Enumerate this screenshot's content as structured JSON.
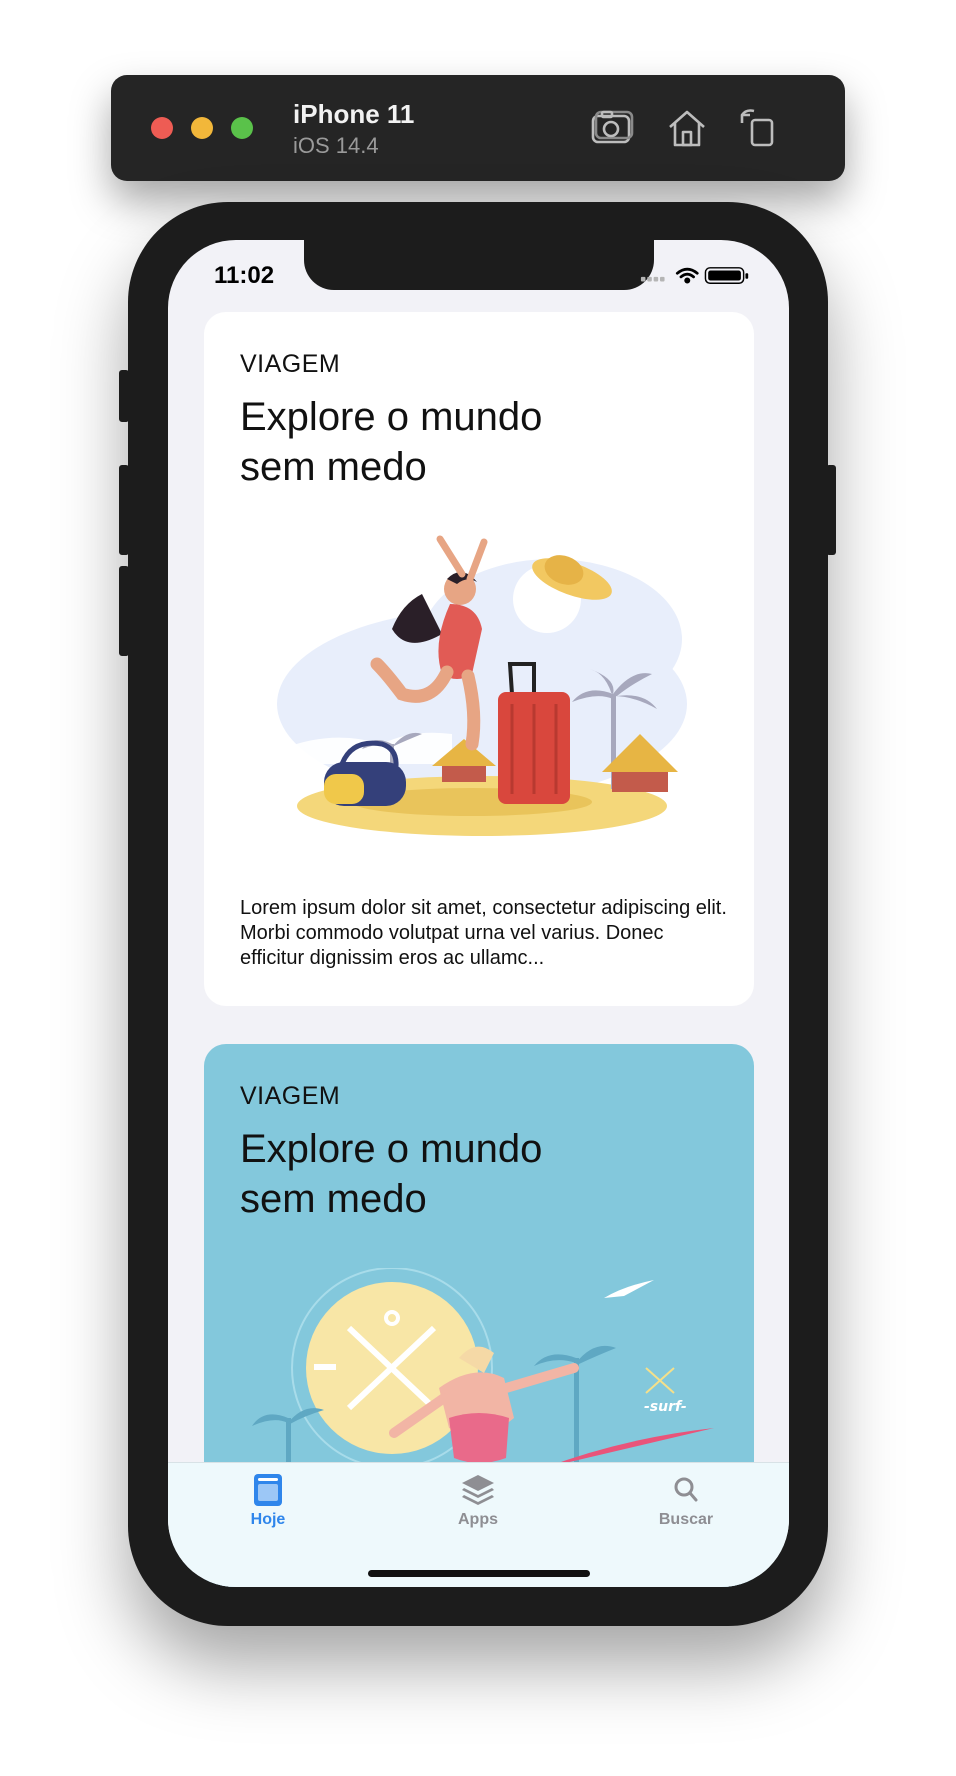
{
  "simulator": {
    "device": "iPhone 11",
    "os": "iOS 14.4",
    "icons": [
      "screenshot-icon",
      "home-icon",
      "rotate-icon"
    ]
  },
  "status_bar": {
    "time": "11:02"
  },
  "cards": [
    {
      "category": "VIAGEM",
      "title": "Explore o mundo sem medo",
      "description": "Lorem ipsum dolor sit amet, consectetur adipiscing elit. Morbi commodo volutpat urna vel varius. Donec efficitur dignissim eros ac ullamc...",
      "background": "#ffffff"
    },
    {
      "category": "VIAGEM",
      "title": "Explore o mundo sem medo",
      "background": "#83c8dc"
    }
  ],
  "tab_bar": {
    "tabs": [
      {
        "label": "Hoje",
        "icon": "today-icon",
        "selected": true
      },
      {
        "label": "Apps",
        "icon": "apps-stack-icon",
        "selected": false
      },
      {
        "label": "Buscar",
        "icon": "search-icon",
        "selected": false
      }
    ],
    "accent": "#2f86eb"
  }
}
